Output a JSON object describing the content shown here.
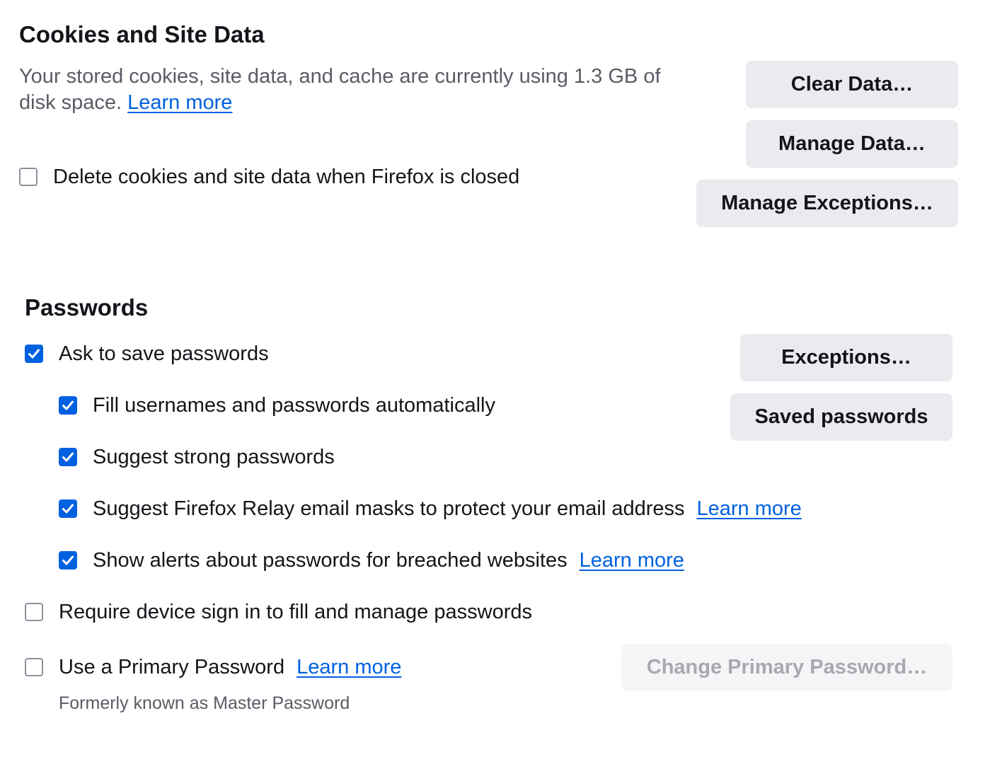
{
  "cookies": {
    "heading": "Cookies and Site Data",
    "description": "Your stored cookies, site data, and cache are currently using 1.3 GB of disk space.",
    "learn_more": "Learn more",
    "delete_on_close": {
      "label": "Delete cookies and site data when Firefox is closed",
      "checked": false
    },
    "buttons": {
      "clear_data": "Clear Data…",
      "manage_data": "Manage Data…",
      "manage_exceptions": "Manage Exceptions…"
    }
  },
  "passwords": {
    "heading": "Passwords",
    "ask_to_save": {
      "label": "Ask to save passwords",
      "checked": true
    },
    "fill_auto": {
      "label": "Fill usernames and passwords automatically",
      "checked": true
    },
    "suggest_strong": {
      "label": "Suggest strong passwords",
      "checked": true
    },
    "relay": {
      "label": "Suggest Firefox Relay email masks to protect your email address",
      "checked": true,
      "learn_more": "Learn more"
    },
    "breach_alerts": {
      "label": "Show alerts about passwords for breached websites",
      "checked": true,
      "learn_more": "Learn more"
    },
    "device_signin": {
      "label": "Require device sign in to fill and manage passwords",
      "checked": false
    },
    "primary_password": {
      "label": "Use a Primary Password",
      "checked": false,
      "learn_more": "Learn more",
      "note": "Formerly known as Master Password"
    },
    "buttons": {
      "exceptions": "Exceptions…",
      "saved_passwords": "Saved passwords",
      "change_primary": "Change Primary Password…"
    }
  },
  "colors": {
    "accent": "#0061e0",
    "button_bg": "#ebebef",
    "text": "#15141a",
    "secondary_text": "#5b5b66"
  }
}
